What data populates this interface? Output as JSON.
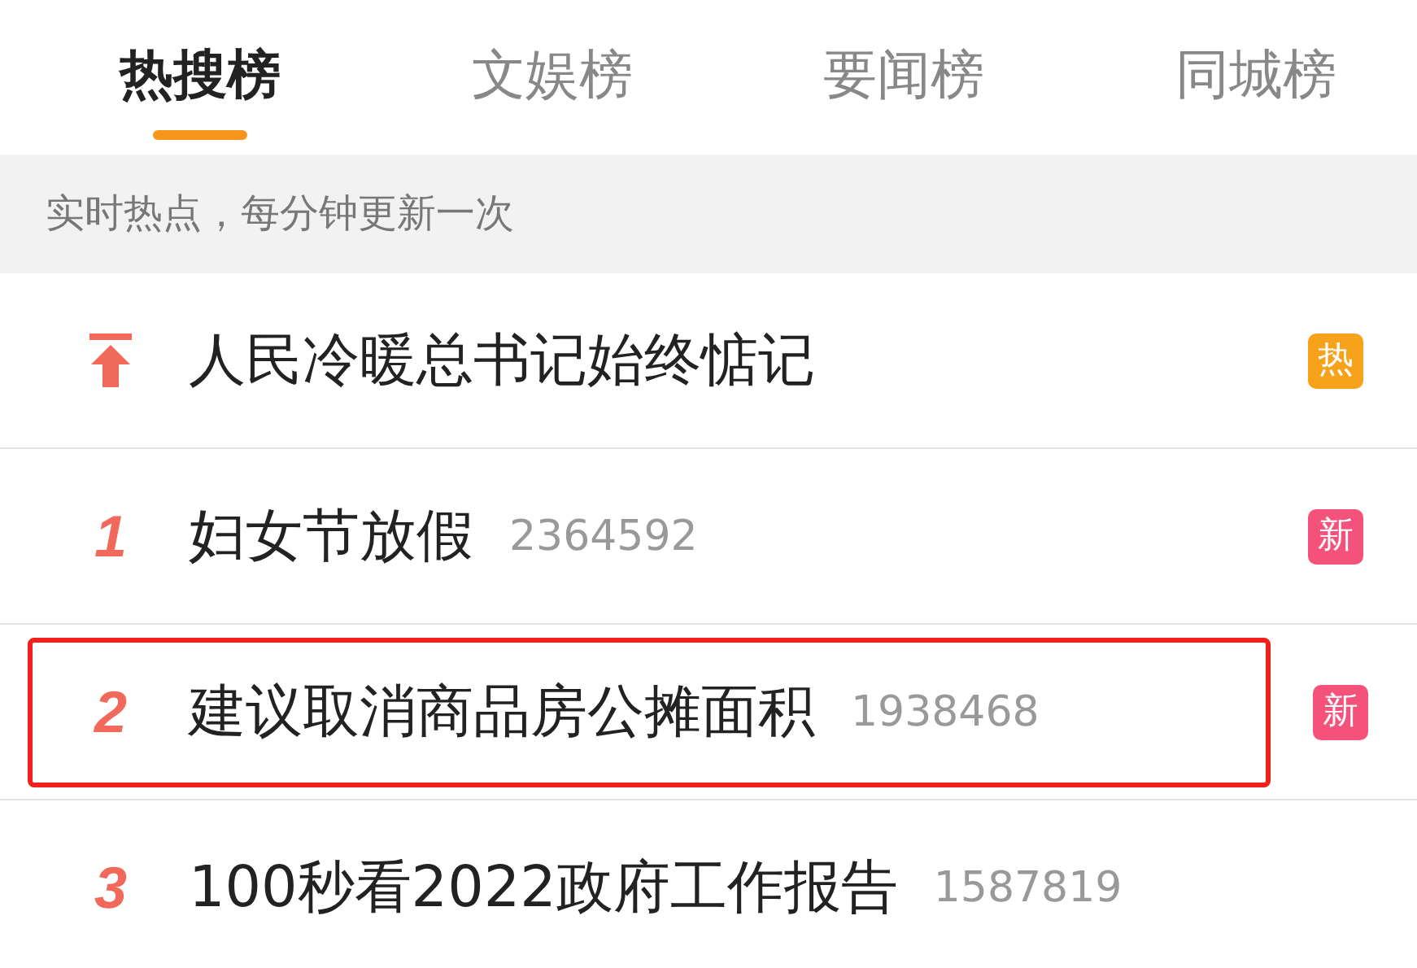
{
  "tabs": [
    {
      "label": "热搜榜",
      "selected": true
    },
    {
      "label": "文娱榜",
      "selected": false
    },
    {
      "label": "要闻榜",
      "selected": false
    },
    {
      "label": "同城榜",
      "selected": false
    }
  ],
  "notice": "实时热点，每分钟更新一次",
  "rows": [
    {
      "kind": "pinned",
      "title": "人民冷暖总书记始终惦记",
      "badge": "热",
      "color": "#f7a21b",
      "highlighted": false
    },
    {
      "kind": "ranked",
      "rank": "1",
      "title": "妇女节放假",
      "count": "2364592",
      "badge": "新",
      "color": "#f5527b",
      "highlighted": false
    },
    {
      "kind": "ranked",
      "rank": "2",
      "title": "建议取消商品房公摊面积",
      "count": "1938468",
      "badge": "新",
      "color": "#f5527b",
      "highlighted": true
    },
    {
      "kind": "ranked",
      "rank": "3",
      "title": "100秒看2022政府工作报告",
      "count": "1587819",
      "highlighted": false
    }
  ]
}
